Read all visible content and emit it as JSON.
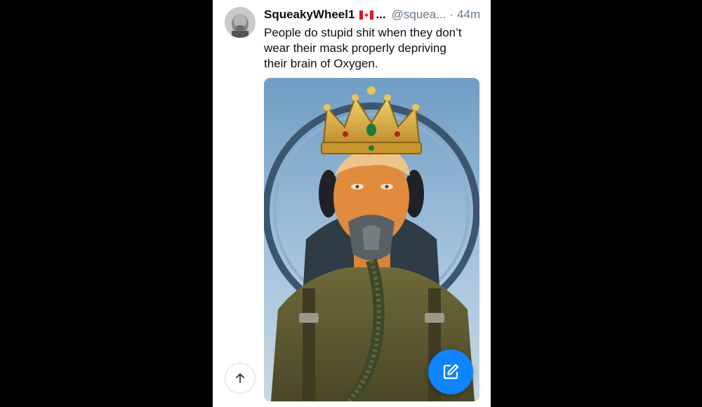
{
  "post": {
    "display_name": "SqueakyWheel1",
    "name_truncation": "...",
    "handle": "@squea...",
    "separator": "·",
    "timestamp": "44m",
    "text": "People do stupid shit when they don’t\nwear their mask properly depriving\ntheir brain of Oxygen.",
    "flag_icon": "canada-flag-icon",
    "media_icon": "pilot-with-crown-image"
  },
  "controls": {
    "scroll_top_icon": "arrow-up-icon",
    "compose_icon": "compose-icon"
  },
  "colors": {
    "accent": "#1083fe",
    "muted_text": "#66788a",
    "primary_text": "#0b0f14"
  }
}
